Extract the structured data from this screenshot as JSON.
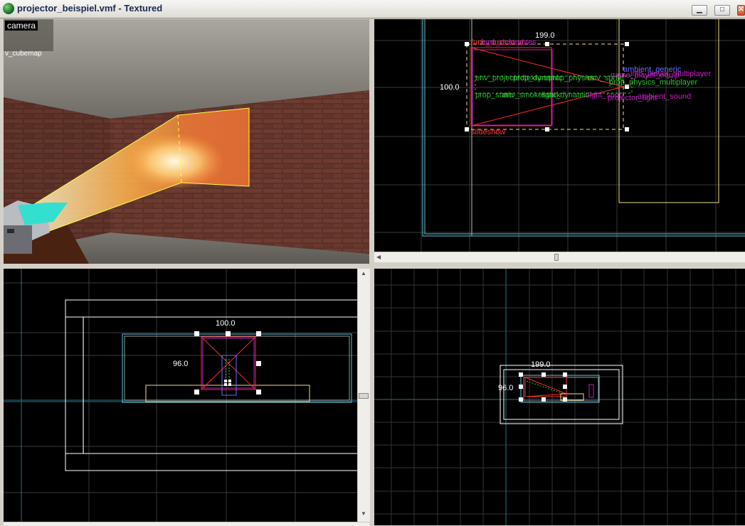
{
  "window": {
    "title": "projector_beispiel.vmf - Textured",
    "buttons": {
      "minimize": "▁",
      "maximize": "□",
      "close": "✕"
    }
  },
  "camera_view": {
    "label": "camera",
    "sublabel": "v_cubemap"
  },
  "top_view": {
    "width_label": "199.0",
    "height_label": "100.0",
    "entity_labels": {
      "func_dustcloud": "func_dustcloud",
      "func_dustmotes": "func_dustmotes",
      "env_projectedtexture": "env_projectedtexture",
      "prop_dynamic": "prop_dynamic",
      "prop_physics": "prop_physics",
      "env_sprite": "env_sprite",
      "slideshow": "slideshow",
      "env_smokestack": "env_smokestack",
      "prop_static": "prop_static",
      "ambient_generic": "ambient_generic",
      "light_dynamic": "light_dynamic",
      "game_player_equip": "game_player_equip",
      "info_player_multiplayer": "info_player_multiplayer",
      "prop_physics_multiplayer": "prop_physics_multiplayer",
      "light_spot": "light_spot",
      "ambient_sound": "ambient_sound",
      "projector_light": "projector_light"
    }
  },
  "front_view": {
    "width_label": "100.0",
    "height_label": "96.0"
  },
  "side_view": {
    "width_label": "199.0",
    "height_label": "96.0"
  },
  "colors": {
    "grid": "#3c3c3c",
    "grid_major": "#2a6f86",
    "brush_white": "#ffffff",
    "selection_red": "#ff2a2a",
    "entity_magenta": "#c020c0",
    "entity_green": "#2fbf2f",
    "brush_yellow": "#f0e08a",
    "cyan": "#5fc8e0"
  }
}
